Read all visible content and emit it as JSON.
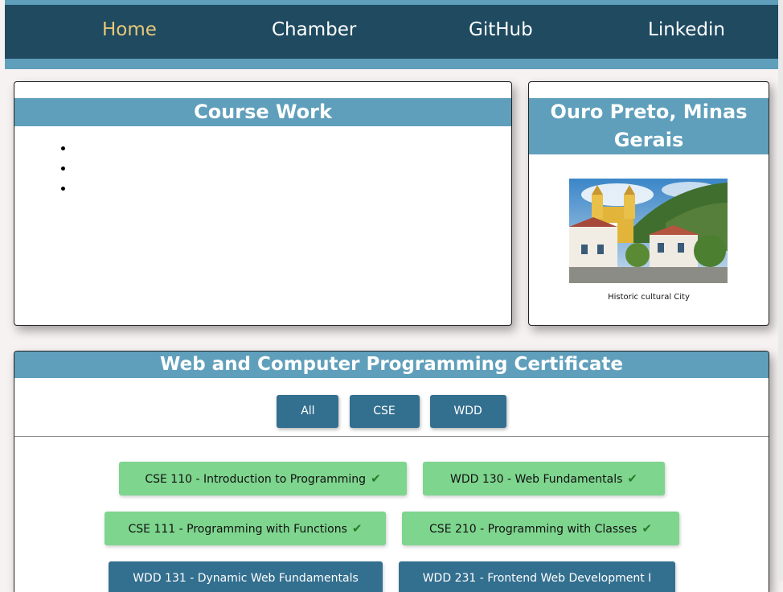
{
  "nav": {
    "home": "Home",
    "chamber": "Chamber",
    "github": "GitHub",
    "linkedin": "Linkedin"
  },
  "course_work": {
    "title": "Course Work",
    "items": [
      "",
      "",
      ""
    ]
  },
  "place": {
    "title": "Ouro Preto, Minas Gerais",
    "caption": "Historic cultural City"
  },
  "certificate": {
    "title": "Web and Computer Programming Certificate",
    "filters": [
      "All",
      "CSE",
      "WDD"
    ],
    "courses": [
      {
        "label": "CSE 110 - Introduction to Programming",
        "completed": true
      },
      {
        "label": "WDD 130 - Web Fundamentals",
        "completed": true
      },
      {
        "label": "CSE 111 - Programming with Functions",
        "completed": true
      },
      {
        "label": "CSE 210 - Programming with Classes",
        "completed": true
      },
      {
        "label": "WDD 131 - Dynamic Web Fundamentals",
        "completed": false
      },
      {
        "label": "WDD 231 - Frontend Web Development I",
        "completed": false
      }
    ]
  },
  "colors": {
    "nav_bg": "#1f4a60",
    "accent": "#5f9fbb",
    "active_link": "#e8c878",
    "completed": "#7ed58e",
    "incomplete": "#336f8f"
  }
}
